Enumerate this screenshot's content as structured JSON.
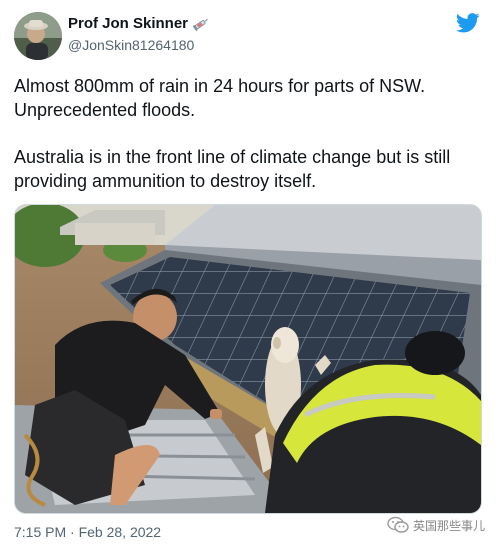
{
  "tweet": {
    "display_name": "Prof Jon Skinner",
    "name_emoji": "syringe-icon",
    "handle": "@JonSkin81264180",
    "text_paragraphs": [
      "Almost 800mm of rain in 24 hours for parts of NSW. Unprecedented floods.",
      "Australia is in the front line of climate change but is still providing ammunition to destroy itself."
    ],
    "timestamp": "7:15 PM · Feb 28, 2022"
  },
  "brand": {
    "icon": "twitter-bird-icon",
    "color": "#1d9bf0"
  },
  "watermark": {
    "icon": "wechat-icon",
    "text": "英国那些事儿"
  },
  "colors": {
    "text": "#0f1419",
    "secondary": "#536471",
    "border": "#cfd9de"
  }
}
